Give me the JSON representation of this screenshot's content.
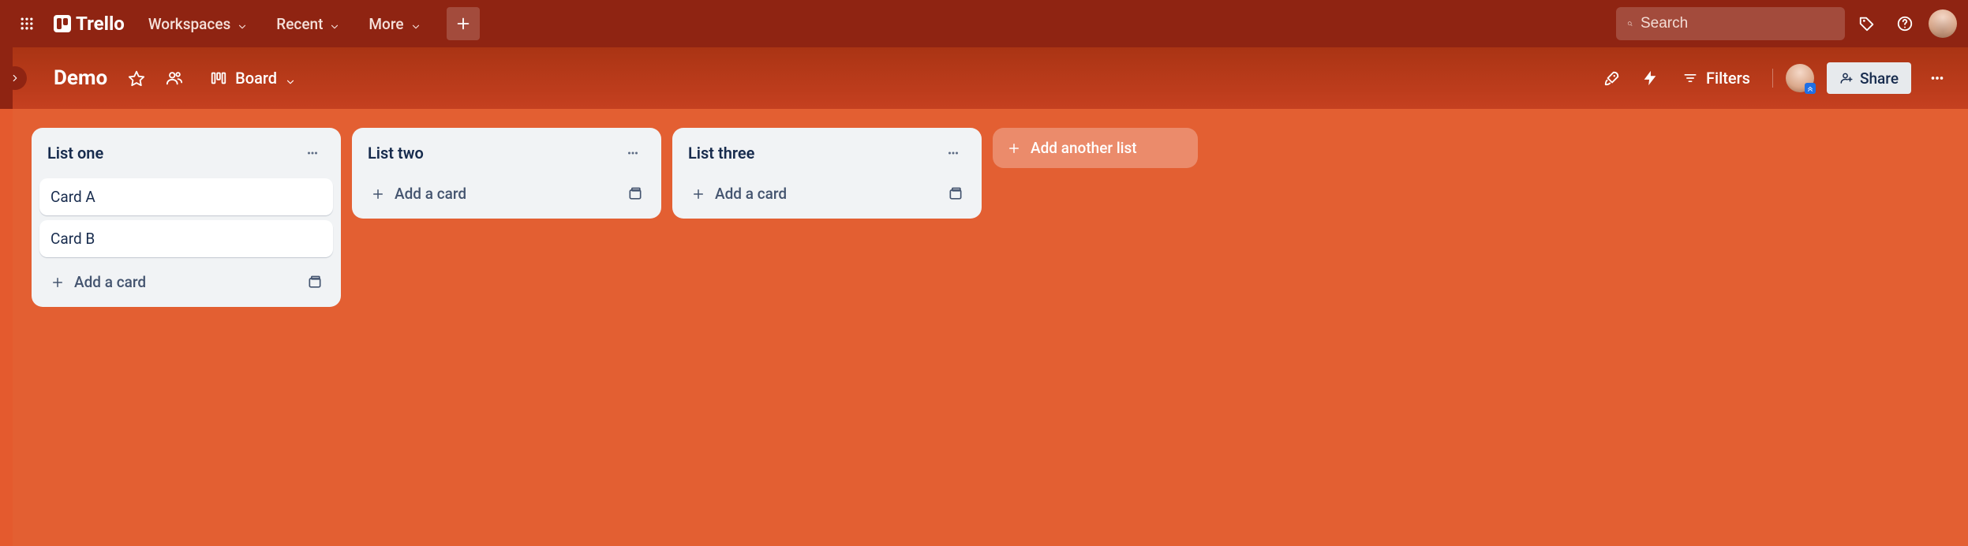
{
  "brand": "Trello",
  "nav": {
    "workspaces": "Workspaces",
    "recent": "Recent",
    "more": "More",
    "search_placeholder": "Search"
  },
  "board": {
    "title": "Demo",
    "view_label": "Board",
    "filters_label": "Filters",
    "share_label": "Share"
  },
  "lists": [
    {
      "title": "List one",
      "cards": [
        "Card A",
        "Card B"
      ],
      "add_card_label": "Add a card"
    },
    {
      "title": "List two",
      "cards": [],
      "add_card_label": "Add a card"
    },
    {
      "title": "List three",
      "cards": [],
      "add_card_label": "Add a card"
    }
  ],
  "add_list_label": "Add another list",
  "colors": {
    "topnav": "#8f2412",
    "boardbar": "#bb3d1d",
    "canvas": "#e35f32",
    "list_bg": "#f1f3f5",
    "text_primary": "#172b4d"
  }
}
